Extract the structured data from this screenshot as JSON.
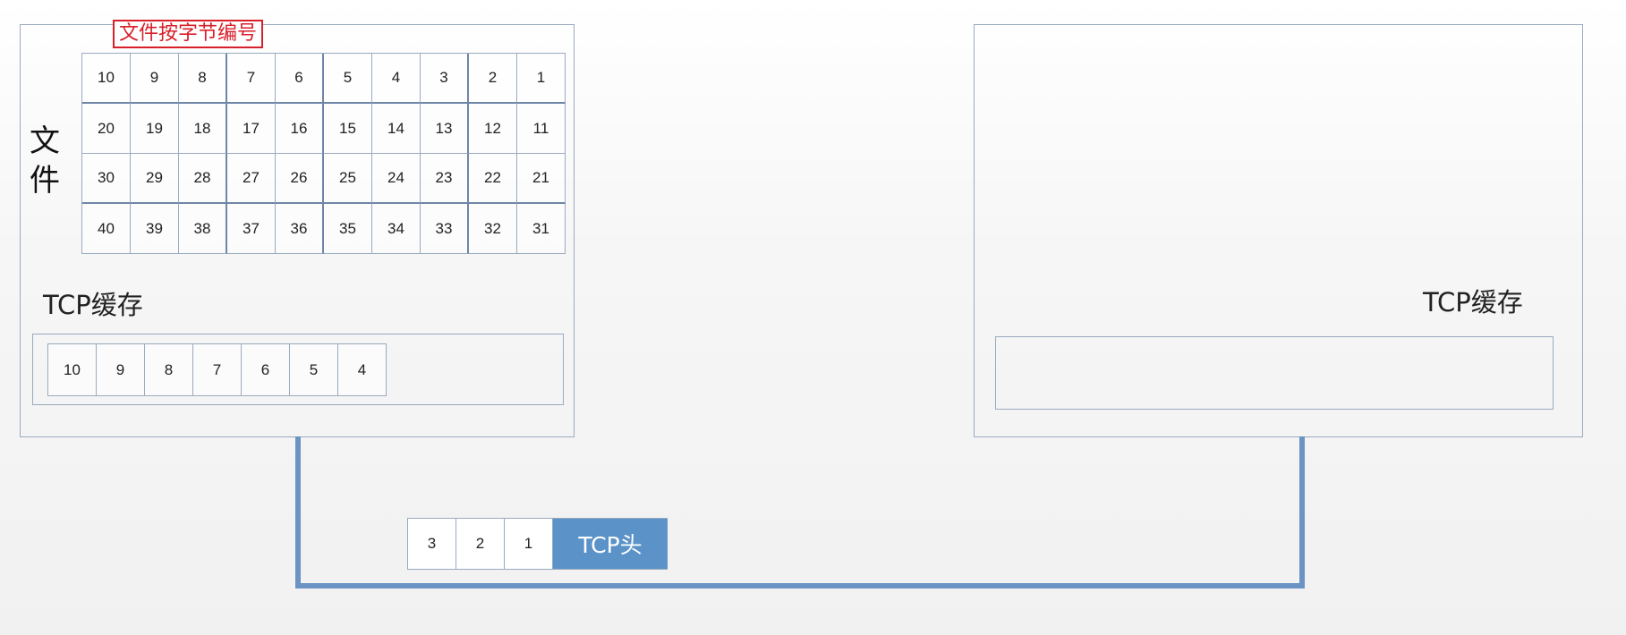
{
  "sender": {
    "file_label": "文件",
    "annotation": "文件按字节编号",
    "file_rows": [
      [
        "10",
        "9",
        "8",
        "7",
        "6",
        "5",
        "4",
        "3",
        "2",
        "1"
      ],
      [
        "20",
        "19",
        "18",
        "17",
        "16",
        "15",
        "14",
        "13",
        "12",
        "11"
      ],
      [
        "30",
        "29",
        "28",
        "27",
        "26",
        "25",
        "24",
        "23",
        "22",
        "21"
      ],
      [
        "40",
        "39",
        "38",
        "37",
        "36",
        "35",
        "34",
        "33",
        "32",
        "31"
      ]
    ],
    "cache_label": "TCP缓存",
    "buffer_bytes": [
      "10",
      "9",
      "8",
      "7",
      "6",
      "5",
      "4"
    ]
  },
  "receiver": {
    "cache_label": "TCP缓存"
  },
  "segment": {
    "bytes": [
      "3",
      "2",
      "1"
    ],
    "header_label": "TCP头"
  },
  "colors": {
    "annotation_red": "#d8202a",
    "link_blue": "#6b93c4",
    "header_blue": "#5b93c9",
    "border": "#9aaac0"
  }
}
